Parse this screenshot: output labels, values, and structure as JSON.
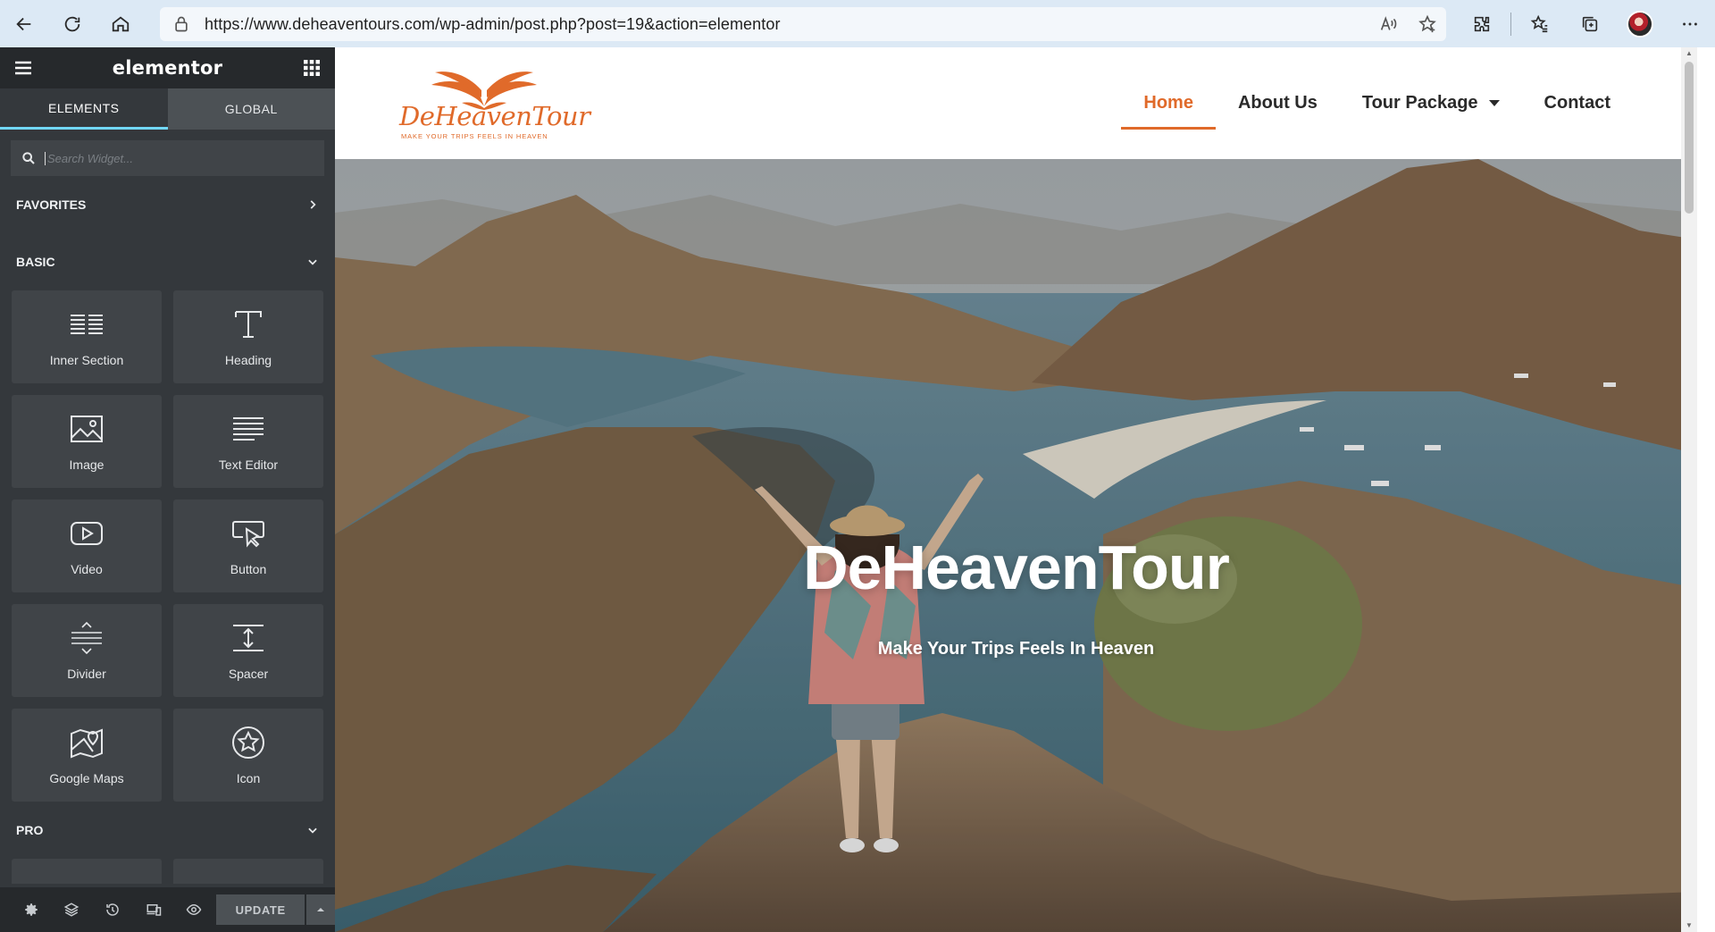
{
  "browser": {
    "url": "https://www.deheaventours.com/wp-admin/post.php?post=19&action=elementor"
  },
  "panel": {
    "logo": "elementor",
    "tabs": [
      {
        "label": "ELEMENTS",
        "active": true
      },
      {
        "label": "GLOBAL",
        "active": false
      }
    ],
    "search_placeholder": "Search Widget...",
    "categories": {
      "favorites": "FAVORITES",
      "basic": "BASIC",
      "pro": "PRO"
    },
    "widgets": [
      {
        "label": "Inner Section",
        "icon": "inner-section-icon"
      },
      {
        "label": "Heading",
        "icon": "heading-icon"
      },
      {
        "label": "Image",
        "icon": "image-icon"
      },
      {
        "label": "Text Editor",
        "icon": "text-editor-icon"
      },
      {
        "label": "Video",
        "icon": "video-icon"
      },
      {
        "label": "Button",
        "icon": "button-icon"
      },
      {
        "label": "Divider",
        "icon": "divider-icon"
      },
      {
        "label": "Spacer",
        "icon": "spacer-icon"
      },
      {
        "label": "Google Maps",
        "icon": "google-maps-icon"
      },
      {
        "label": "Icon",
        "icon": "star-icon"
      }
    ],
    "footer": {
      "update_label": "UPDATE"
    }
  },
  "site": {
    "logo": {
      "name": "DeHeavenTour",
      "tagline": "MAKE YOUR TRIPS FEELS IN HEAVEN"
    },
    "nav": [
      {
        "label": "Home",
        "active": true
      },
      {
        "label": "About Us",
        "active": false
      },
      {
        "label": "Tour Package",
        "active": false,
        "has_dropdown": true
      },
      {
        "label": "Contact",
        "active": false
      }
    ],
    "hero": {
      "title": "DeHeavenTour",
      "subtitle": "Make Your Trips Feels In Heaven"
    }
  },
  "colors": {
    "accent": "#e06a2a",
    "panel_bg": "#34383c",
    "panel_header": "#26292c",
    "tab_indicator": "#71d7f7",
    "browser_bar": "#dce9f5"
  }
}
